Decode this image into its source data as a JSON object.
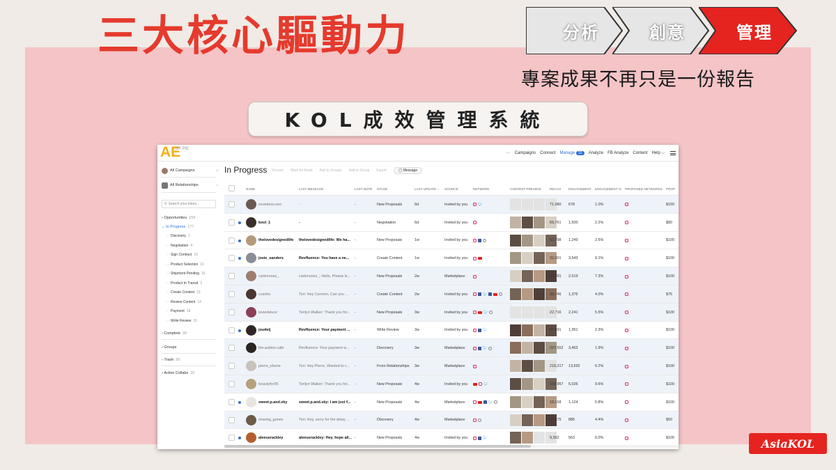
{
  "slide": {
    "headline": "三大核心驅動力",
    "steps": [
      {
        "label": "分析",
        "color": "#e6e6e6"
      },
      {
        "label": "創意",
        "color": "#e6e6e6"
      },
      {
        "label": "管理",
        "color": "#e52420"
      }
    ],
    "subtitle": "專案成果不再只是一份報告",
    "system_title": "KOL成效管理系統",
    "brand_logo": "AsiaKOL"
  },
  "app": {
    "logo_text": "AE",
    "logo_small": "BY PIE",
    "nav": {
      "more": "···",
      "items": [
        {
          "label": "Campaigns"
        },
        {
          "label": "Connect"
        },
        {
          "label": "Manage",
          "badge": "31",
          "active": true
        },
        {
          "label": "Analyze"
        },
        {
          "label": "FB Analyze"
        },
        {
          "label": "Content"
        },
        {
          "label": "Help ⌵"
        }
      ]
    },
    "sidebar": {
      "campaigns_select": "All Campaigns",
      "relationships_select": "All Relationships",
      "search_placeholder": "Search your inbox...",
      "opportunities": {
        "label": "Opportunities",
        "count": "159"
      },
      "in_progress": {
        "label": "In Progress",
        "count": "177"
      },
      "stages": [
        {
          "label": "Discovery",
          "count": "2"
        },
        {
          "label": "Negotiation",
          "count": "4"
        },
        {
          "label": "Sign Contract",
          "count": "19"
        },
        {
          "label": "Product Selection",
          "count": "10"
        },
        {
          "label": "Shipment Pending",
          "count": "16"
        },
        {
          "label": "Product In Transit",
          "count": "3"
        },
        {
          "label": "Create Content",
          "count": "10"
        },
        {
          "label": "Review Content",
          "count": "14"
        },
        {
          "label": "Payment",
          "count": "18"
        },
        {
          "label": "Write Review",
          "count": "15"
        }
      ],
      "complete": {
        "label": "Complete",
        "count": "39"
      },
      "groups": {
        "label": "Groups"
      },
      "trash": {
        "label": "Trash",
        "count": "20"
      },
      "active_collabs": {
        "label": "Active Collabs",
        "count": "20"
      }
    },
    "main": {
      "title": "In Progress",
      "toolbar": [
        "Snooze",
        "Mark As Read",
        "Add to Groups",
        "Add to Group",
        "Export"
      ],
      "message_button": "Message",
      "columns": [
        "Name",
        "Last Message",
        "Last Note",
        "Stage",
        "Last Update ⌵",
        "Source",
        "Network",
        "Content Preview",
        "Reach",
        "Engagement",
        "Engagement %",
        "Proposed Networks",
        "Prop"
      ],
      "rows": [
        {
          "name": "soomless.seo",
          "bold": false,
          "unread": false,
          "hl": true,
          "avatar": "#6b5a52",
          "message": "-",
          "note": "-",
          "stage": "New Proposals",
          "update": "6d",
          "source": "Invited by you",
          "network": [
            "ig",
            "tw"
          ],
          "thumbs": 0,
          "reach": "71,080",
          "engagement": "678",
          "eng_pct": "1.0%",
          "proposed": [
            "ig"
          ],
          "price": "$150"
        },
        {
          "name": "kool_1",
          "bold": true,
          "unread": true,
          "hl": false,
          "avatar": "#3a2e2a",
          "message": "-",
          "note": "-",
          "stage": "Negotiation",
          "update": "6d",
          "source": "Invited by you",
          "network": [
            "ig"
          ],
          "thumbs": 4,
          "reach": "69,761",
          "engagement": "1,500",
          "eng_pct": "2.2%",
          "proposed": [
            "ig"
          ],
          "price": "$80"
        },
        {
          "name": "thelovedesignedlife",
          "bold": true,
          "unread": true,
          "hl": false,
          "avatar": "#b59a7a",
          "message": "thelovedesignedlife: We ha...",
          "note": "-",
          "stage": "New Proposals",
          "update": "1w",
          "source": "Invited by you",
          "network": [
            "ig",
            "fb",
            "pin"
          ],
          "thumbs": 4,
          "reach": "52,798",
          "engagement": "1,249",
          "eng_pct": "2.5%",
          "proposed": [
            "ig"
          ],
          "price": "$100"
        },
        {
          "name": "josie_sanders",
          "bold": true,
          "unread": true,
          "hl": false,
          "avatar": "#8a8f96",
          "message": "Revfluence: You have a ne...",
          "note": "-",
          "stage": "Create Content",
          "update": "1w",
          "source": "Invited by you",
          "network": [
            "ig",
            "yt"
          ],
          "thumbs": 4,
          "reach": "32,001",
          "engagement": "3,543",
          "eng_pct": "9.1%",
          "proposed": [
            "ig"
          ],
          "price": "$100"
        },
        {
          "name": "carlenunez_",
          "bold": false,
          "unread": false,
          "hl": true,
          "avatar": "#9e7f6e",
          "message": "carlenunez_: Hello, Please le...",
          "note": "-",
          "stage": "New Proposals",
          "update": "2w",
          "source": "Marketplace",
          "network": [
            "ig"
          ],
          "thumbs": 4,
          "reach": "34,391",
          "engagement": "2,519",
          "eng_pct": "7.3%",
          "proposed": [
            "ig"
          ],
          "price": "$100"
        },
        {
          "name": "cosoho",
          "bold": false,
          "unread": false,
          "hl": true,
          "avatar": "#4a3530",
          "message": "Teri: Hey Carmen, Can you ...",
          "note": "-",
          "stage": "Create Content",
          "update": "2w",
          "source": "Invited by you",
          "network": [
            "ig",
            "fb",
            "tw",
            "fb",
            "yt",
            "pin"
          ],
          "thumbs": 4,
          "reach": "39,746",
          "engagement": "1,376",
          "eng_pct": "4.0%",
          "proposed": [
            "ig"
          ],
          "price": "$75"
        },
        {
          "name": "laviedeluce",
          "bold": false,
          "unread": false,
          "hl": true,
          "avatar": "#8c3f56",
          "message": "Terilyn Walker: Thank you for...",
          "note": "-",
          "stage": "New Proposals",
          "update": "3w",
          "source": "Invited by you",
          "network": [
            "ig",
            "yt",
            "tw",
            "pin"
          ],
          "thumbs": 0,
          "reach": "22,716",
          "engagement": "2,241",
          "eng_pct": "5.5%",
          "proposed": [
            "ig"
          ],
          "price": "$100"
        },
        {
          "name": "joudeij",
          "bold": true,
          "unread": true,
          "hl": false,
          "avatar": "#2e2624",
          "message": "Revfluence: Your payment ...",
          "note": "-",
          "stage": "Write Review",
          "update": "3w",
          "source": "Invited by you",
          "network": [
            "ig",
            "fb",
            "tw"
          ],
          "thumbs": 4,
          "reach": "87,491",
          "engagement": "1,951",
          "eng_pct": "2.3%",
          "proposed": [
            "ig"
          ],
          "price": "$100"
        },
        {
          "name": "the.autism.cafe",
          "bold": false,
          "unread": false,
          "hl": true,
          "avatar": "#2a2522",
          "message": "Revfluence: Your payment w...",
          "note": "-",
          "stage": "Discovery",
          "update": "3w",
          "source": "Marketplace",
          "network": [
            "ig",
            "fb",
            "tw",
            "pin"
          ],
          "thumbs": 4,
          "reach": "227,652",
          "engagement": "3,463",
          "eng_pct": "1.9%",
          "proposed": [
            "ig"
          ],
          "price": "$100"
        },
        {
          "name": "pierre_ebene",
          "bold": false,
          "unread": false,
          "hl": true,
          "avatar": "#c8c2bd",
          "message": "Teri: Hey Pierre, Wanted to c...",
          "note": "-",
          "stage": "From Relationships",
          "update": "3w",
          "source": "Marketplace",
          "network": [
            "ig"
          ],
          "thumbs": 3,
          "reach": "218,217",
          "engagement": "13,592",
          "eng_pct": "6.2%",
          "proposed": [
            "ig"
          ],
          "price": "$100"
        },
        {
          "name": "beautyfor05",
          "bold": false,
          "unread": false,
          "hl": true,
          "avatar": "#b5a27a",
          "message": "Terilyn Walker: Thank you for...",
          "note": "-",
          "stage": "New Proposals",
          "update": "4w",
          "source": "Invited by you",
          "network": [
            "yt",
            "ig",
            "tw"
          ],
          "thumbs": 4,
          "reach": "102,957",
          "engagement": "5,026",
          "eng_pct": "9.6%",
          "proposed": [
            "ig"
          ],
          "price": "$100"
        },
        {
          "name": "sweet.p.and.sky",
          "bold": true,
          "unread": true,
          "hl": false,
          "avatar": "#e8e4df",
          "message": "sweet.p.and.sky: I am just f...",
          "note": "-",
          "stage": "New Proposals",
          "update": "4w",
          "source": "Marketplace",
          "network": [
            "ig",
            "yt",
            "fb",
            "tw",
            "pin"
          ],
          "thumbs": 4,
          "reach": "18,158",
          "engagement": "1,124",
          "eng_pct": "5.8%",
          "proposed": [
            "ig"
          ],
          "price": "$100"
        },
        {
          "name": "sharing_gones",
          "bold": false,
          "unread": false,
          "hl": true,
          "avatar": "#6e5a48",
          "message": "Teri: Hey, sorry for the delay ...",
          "note": "-",
          "stage": "Discovery",
          "update": "4w",
          "source": "Marketplace",
          "network": [
            "ig",
            "pin"
          ],
          "thumbs": 4,
          "reach": "20,675",
          "engagement": "885",
          "eng_pct": "4.4%",
          "proposed": [
            "ig"
          ],
          "price": "$50"
        },
        {
          "name": "aleeusrackley",
          "bold": true,
          "unread": true,
          "hl": false,
          "avatar": "#b4602e",
          "message": "aleeusrackley: Hey, hope all...",
          "note": "-",
          "stage": "New Proposals",
          "update": "4w",
          "source": "Invited by you",
          "network": [
            "ig",
            "fb",
            "tw"
          ],
          "thumbs": 2,
          "reach": "9,352",
          "engagement": "563",
          "eng_pct": "6.0%",
          "proposed": [
            "ig"
          ],
          "price": "$100"
        }
      ]
    }
  }
}
